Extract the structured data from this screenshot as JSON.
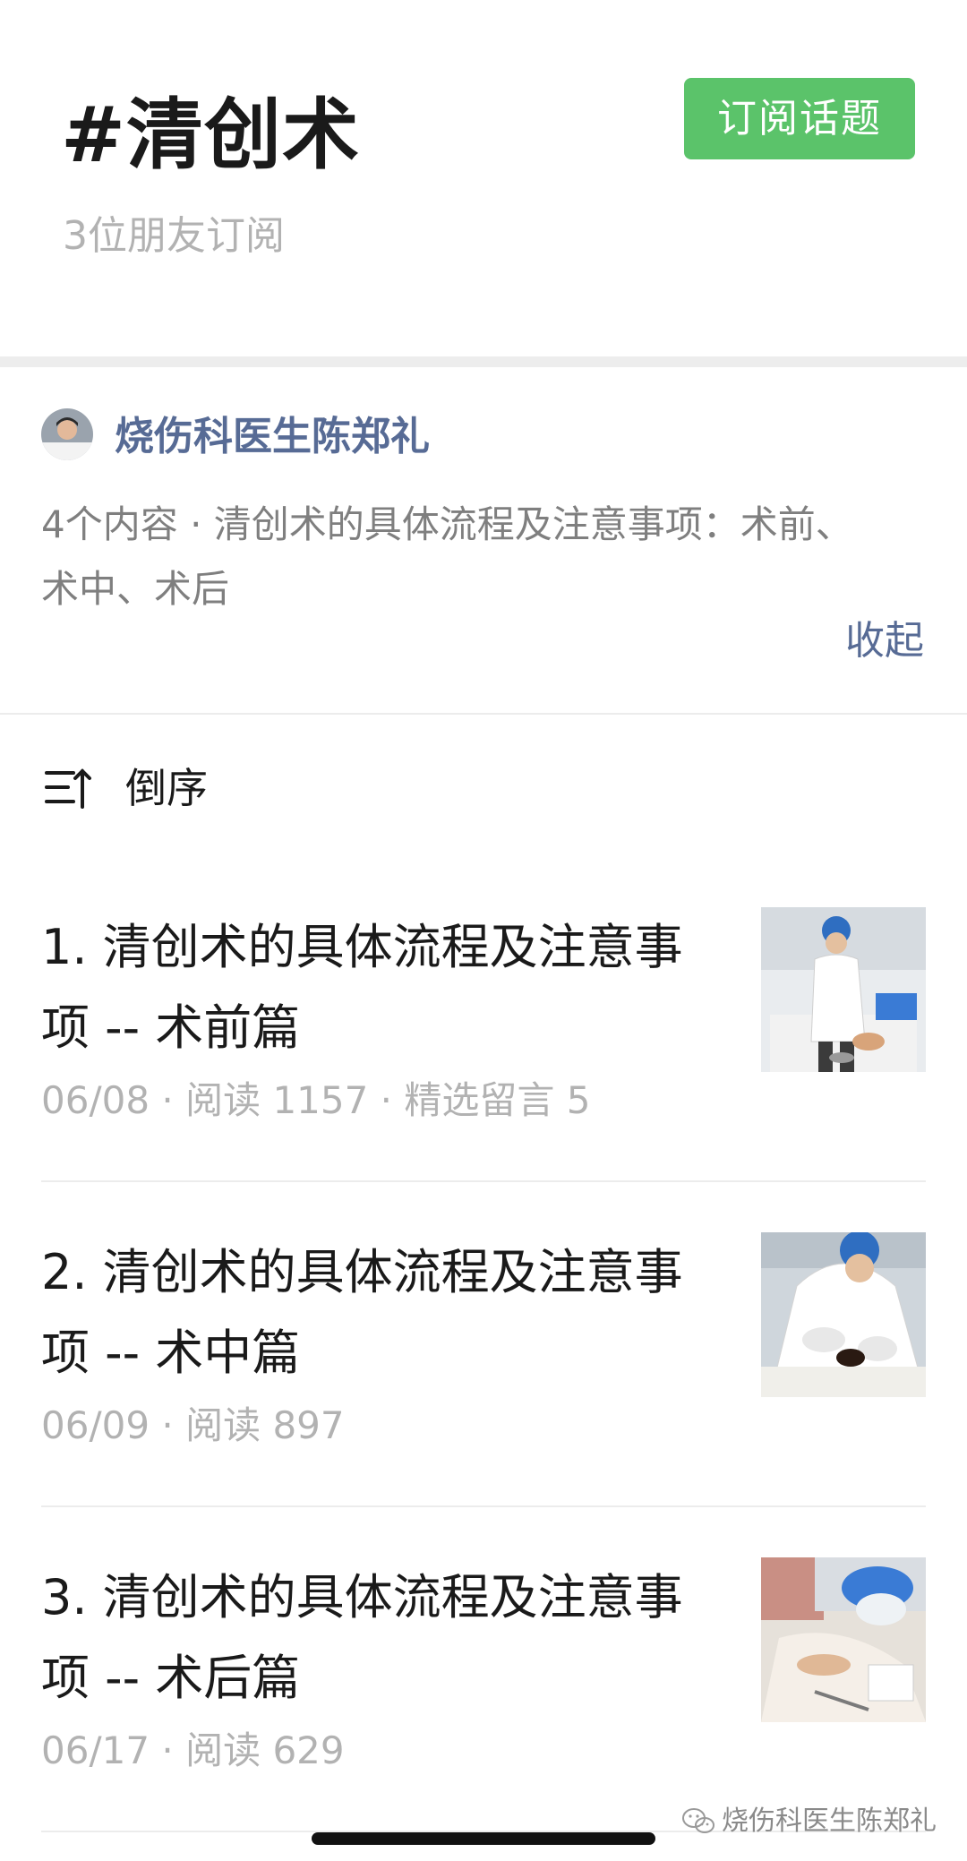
{
  "topic": {
    "title": "#清创术",
    "subscribers": "3位朋友订阅",
    "subscribe_label": "订阅话题"
  },
  "album": {
    "author": "烧伤科医生陈郑礼",
    "description": "4个内容 · 清创术的具体流程及注意事项：术前、术中、术后",
    "collapse_label": "收起"
  },
  "sort": {
    "label": "倒序",
    "icon": "sort-order-icon"
  },
  "articles": [
    {
      "title": "1. 清创术的具体流程及注意事项 -- 术前篇",
      "meta": "06/08 · 阅读 1157 · 精选留言 5"
    },
    {
      "title": "2. 清创术的具体流程及注意事项 -- 术中篇",
      "meta": "06/09 · 阅读 897"
    },
    {
      "title": "3. 清创术的具体流程及注意事项 -- 术后篇",
      "meta": "06/17 · 阅读 629"
    }
  ],
  "watermark": {
    "text": "烧伤科医生陈郑礼",
    "icon": "wechat-icon"
  },
  "colors": {
    "accent_green": "#5bc36a",
    "link_blue": "#576b95",
    "meta_gray": "#b2b2b2"
  }
}
